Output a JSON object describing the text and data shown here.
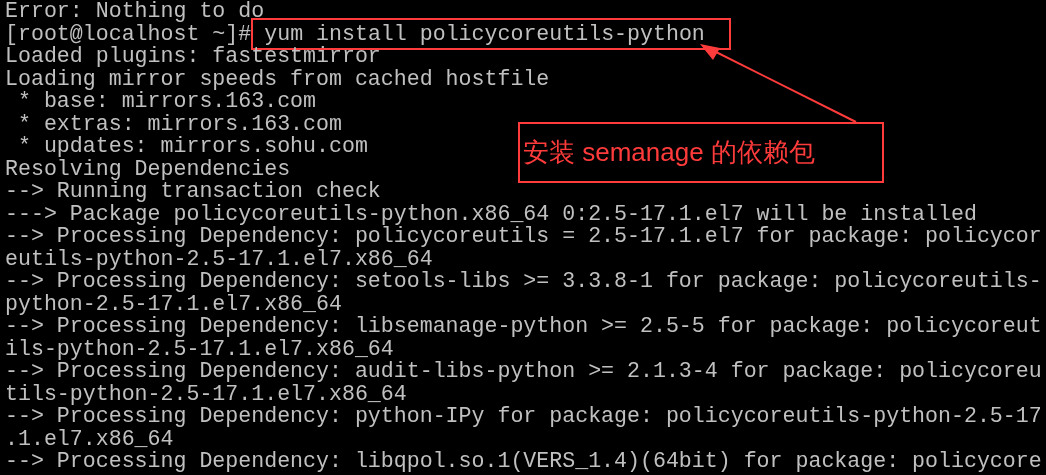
{
  "terminal": {
    "lines": [
      {
        "kind": "output",
        "text": "Error: Nothing to do"
      },
      {
        "kind": "prompt",
        "prompt": "[root@localhost ~]#",
        "command": "yum install policycoreutils-python",
        "highlighted": true
      },
      {
        "kind": "output",
        "text": "Loaded plugins: fastestmirror"
      },
      {
        "kind": "output",
        "text": "Loading mirror speeds from cached hostfile"
      },
      {
        "kind": "output",
        "text": " * base: mirrors.163.com"
      },
      {
        "kind": "output",
        "text": " * extras: mirrors.163.com"
      },
      {
        "kind": "output",
        "text": " * updates: mirrors.sohu.com"
      },
      {
        "kind": "output",
        "text": "Resolving Dependencies"
      },
      {
        "kind": "output",
        "text": "--> Running transaction check"
      },
      {
        "kind": "output",
        "text": "---> Package policycoreutils-python.x86_64 0:2.5-17.1.el7 will be installed"
      },
      {
        "kind": "output",
        "text": "--> Processing Dependency: policycoreutils = 2.5-17.1.el7 for package: policycor"
      },
      {
        "kind": "output",
        "text": "eutils-python-2.5-17.1.el7.x86_64"
      },
      {
        "kind": "output",
        "text": "--> Processing Dependency: setools-libs >= 3.3.8-1 for package: policycoreutils-"
      },
      {
        "kind": "output",
        "text": "python-2.5-17.1.el7.x86_64"
      },
      {
        "kind": "output",
        "text": "--> Processing Dependency: libsemanage-python >= 2.5-5 for package: policycoreut"
      },
      {
        "kind": "output",
        "text": "ils-python-2.5-17.1.el7.x86_64"
      },
      {
        "kind": "output",
        "text": "--> Processing Dependency: audit-libs-python >= 2.1.3-4 for package: policycoreu"
      },
      {
        "kind": "output",
        "text": "tils-python-2.5-17.1.el7.x86_64"
      },
      {
        "kind": "output",
        "text": "--> Processing Dependency: python-IPy for package: policycoreutils-python-2.5-17"
      },
      {
        "kind": "output",
        "text": ".1.el7.x86_64"
      },
      {
        "kind": "output",
        "text": "--> Processing Dependency: libqpol.so.1(VERS_1.4)(64bit) for package: policycore"
      }
    ]
  },
  "annotation": {
    "text": "安装 semanage 的依赖包"
  }
}
